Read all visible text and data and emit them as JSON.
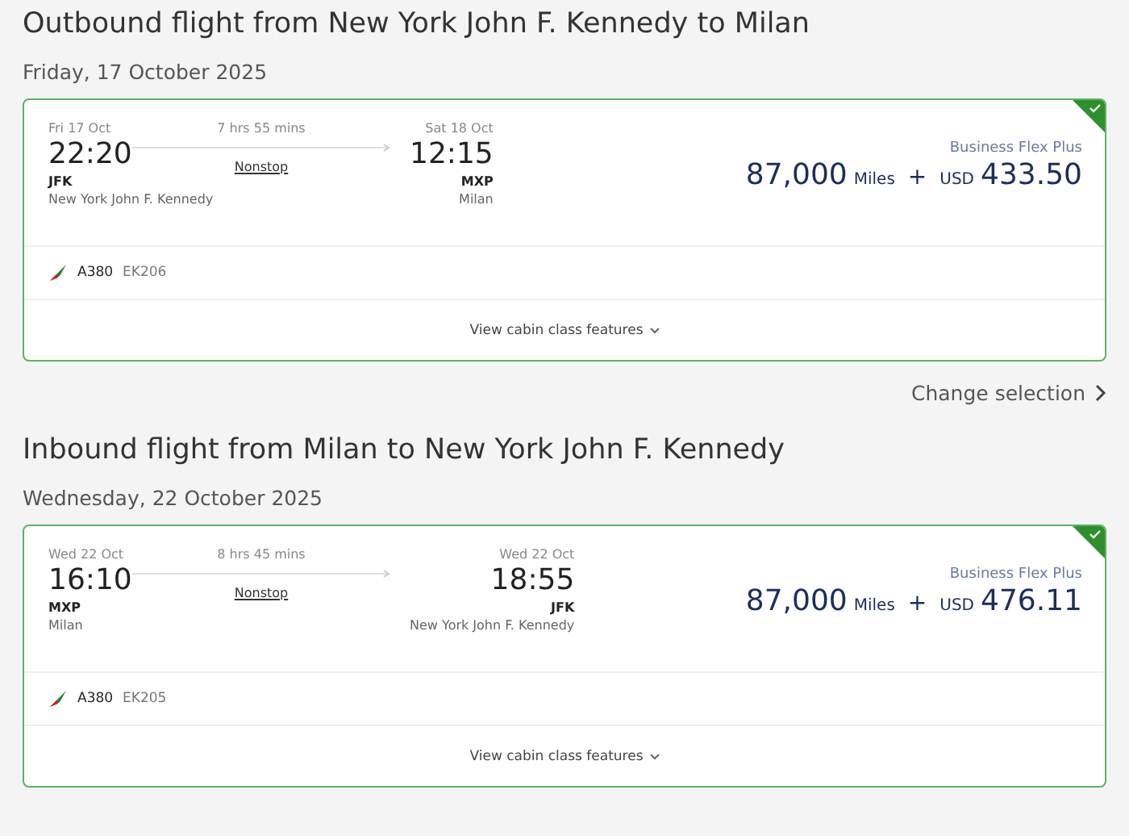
{
  "sections": [
    {
      "title": "Outbound flight from New York John F. Kennedy to Milan",
      "date": "Friday, 17 October 2025",
      "flight": {
        "selected": true,
        "departure": {
          "day": "Fri 17 Oct",
          "time": "22:20",
          "code": "JFK",
          "city": "New York John F. Kennedy"
        },
        "duration": "7 hrs 55 mins",
        "stops": "Nonstop",
        "arrival": {
          "day": "Sat 18 Oct",
          "time": "12:15",
          "code": "MXP",
          "city": "Milan"
        },
        "fare_name": "Business Flex Plus",
        "miles": "87,000",
        "miles_unit": "Miles",
        "plus": "+",
        "currency": "USD",
        "amount": "433.50",
        "aircraft": "A380",
        "flight_number": "EK206",
        "features_link": "View cabin class features"
      },
      "change_link": "Change selection"
    },
    {
      "title": "Inbound flight from Milan to New York John F. Kennedy",
      "date": "Wednesday, 22 October 2025",
      "flight": {
        "selected": true,
        "departure": {
          "day": "Wed 22 Oct",
          "time": "16:10",
          "code": "MXP",
          "city": "Milan"
        },
        "duration": "8 hrs 45 mins",
        "stops": "Nonstop",
        "arrival": {
          "day": "Wed 22 Oct",
          "time": "18:55",
          "code": "JFK",
          "city": "New York John F. Kennedy"
        },
        "fare_name": "Business Flex Plus",
        "miles": "87,000",
        "miles_unit": "Miles",
        "plus": "+",
        "currency": "USD",
        "amount": "476.11",
        "aircraft": "A380",
        "flight_number": "EK205",
        "features_link": "View cabin class features"
      }
    }
  ]
}
